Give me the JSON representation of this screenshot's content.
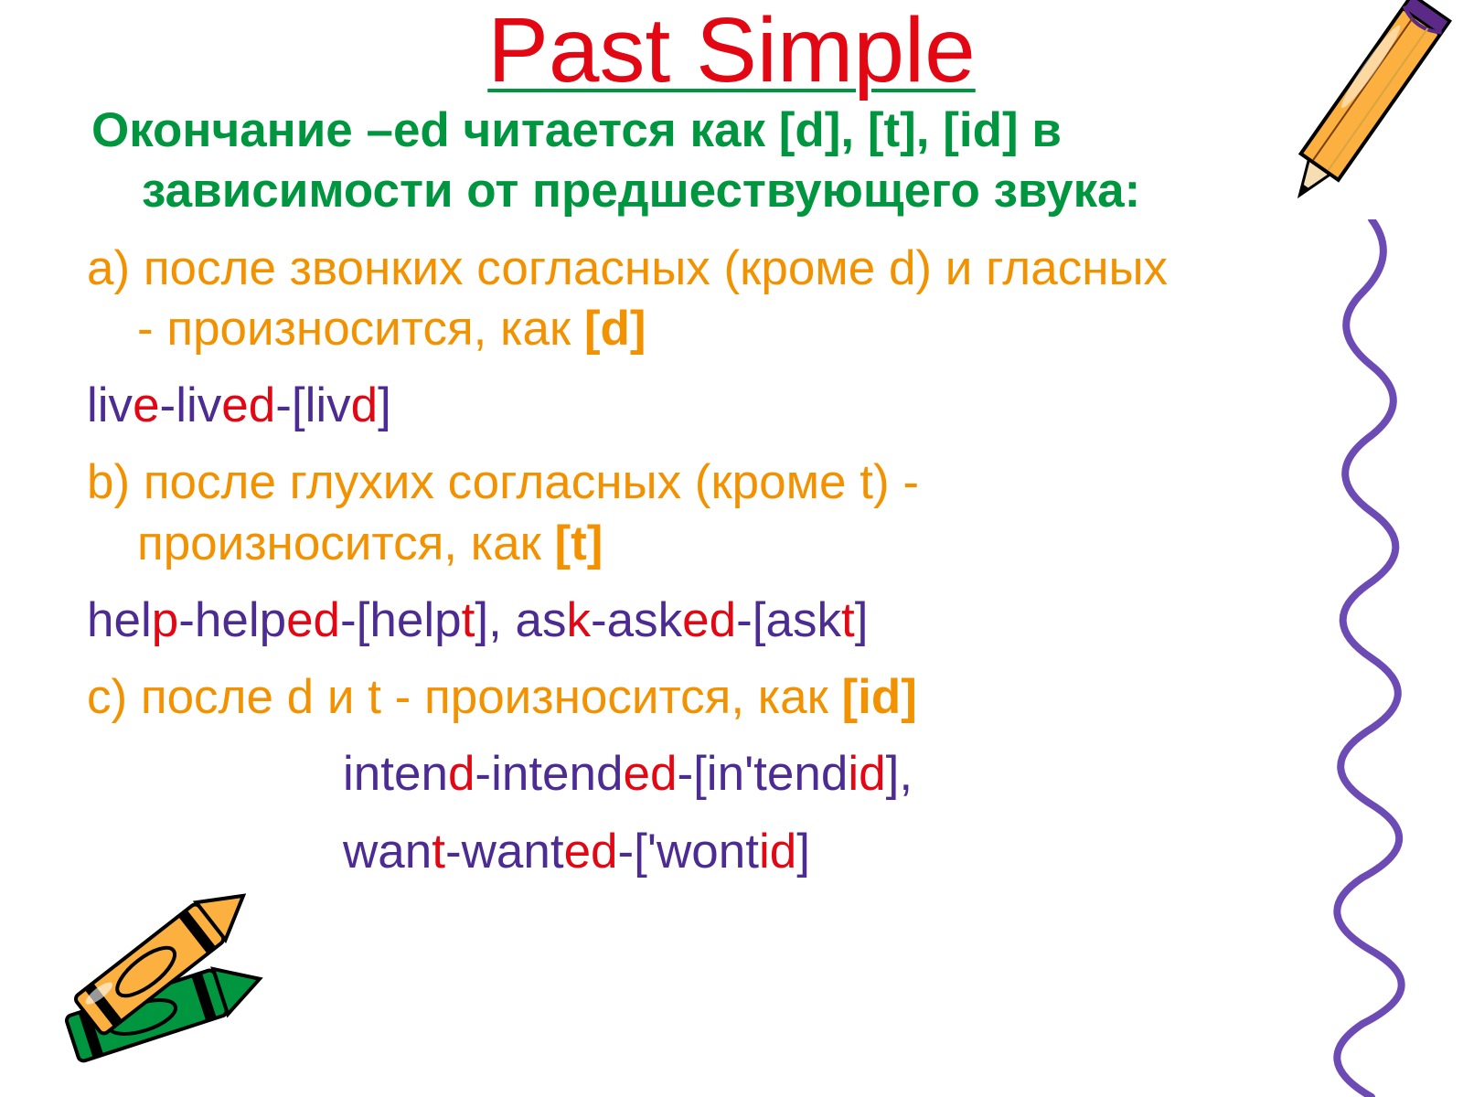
{
  "title": "Past Simple",
  "intro": {
    "line1": "Окончание –ed читается как [d], [t], [id] в",
    "line2": "зависимости от предшествующего звука:"
  },
  "ruleA": {
    "letter": "a) ",
    "text1": "после звонких согласных (кроме d) и гласных",
    "text2": "- произносится, как ",
    "sound": "[d]"
  },
  "exA": {
    "p1": "liv",
    "p2": "e",
    "p3": "-liv",
    "p4": "ed",
    "p5": "-[liv",
    "p6": "d",
    "p7": "]"
  },
  "ruleB": {
    "letter": "b) ",
    "text1": "после глухих согласных (кроме t) -",
    "text2": "произносится, как ",
    "sound": "[t]"
  },
  "exB": {
    "p1": "hel",
    "p2": "p",
    "p3": "-help",
    "p4": "ed",
    "p5": "-[help",
    "p6": "t",
    "p7": "], as",
    "p8": "k",
    "p9": "-ask",
    "p10": "ed",
    "p11": "-[ask",
    "p12": "t",
    "p13": "]"
  },
  "ruleC": {
    "letter": "c) ",
    "text1": "после d и t - произносится, как ",
    "sound": "[id]"
  },
  "exC1": {
    "p1": "inten",
    "p2": "d",
    "p3": "-intend",
    "p4": "ed",
    "p5": "-[in'tend",
    "p6": "id",
    "p7": "],"
  },
  "exC2": {
    "p1": "wan",
    "p2": "t",
    "p3": "-want",
    "p4": "ed",
    "p5": "-['wont",
    "p6": "id",
    "p7": "]"
  }
}
